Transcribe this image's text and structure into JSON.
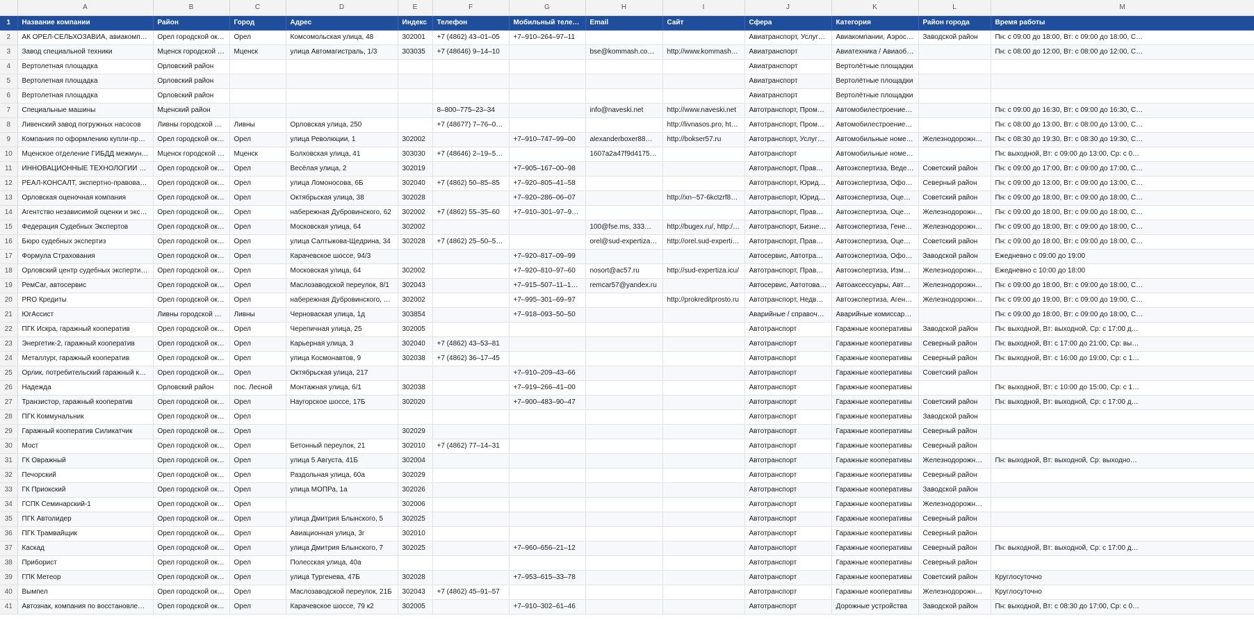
{
  "column_letters": [
    "A",
    "B",
    "C",
    "D",
    "E",
    "F",
    "G",
    "H",
    "I",
    "J",
    "K",
    "L",
    "M"
  ],
  "header_row_number": "1",
  "headers": [
    "Название компании",
    "Район",
    "Город",
    "Адрес",
    "Индекс",
    "Телефон",
    "Мобильный телефон",
    "Email",
    "Сайт",
    "Сфера",
    "Категория",
    "Район города",
    "Время работы"
  ],
  "rows": [
    {
      "n": "2",
      "c": [
        "АК ОРЕЛ-СЕЛЬХОЗАВИА, авиакомпан…",
        "Орел городской округ",
        "Орел",
        "Комсомольская улица, 48",
        "302001",
        "+7 (4862) 43–01–05",
        "+7–910–264–97–11",
        "",
        "",
        "Авиатранспорт, Услуги по…",
        "Авиакомпании, Аэросъёмка",
        "Заводской район",
        "Пн: с 09:00 до 18:00, Вт: с 09:00 до 18:00, С…"
      ]
    },
    {
      "n": "3",
      "c": [
        "Завод специальной техники",
        "Мценск городской окр…",
        "Мценск",
        "улица Автомагистраль, 1/3",
        "303035",
        "+7 (48646) 9–14–10",
        "",
        "bse@kommash.com, ex…",
        "http://www.kommash.com",
        "Авиатранспорт",
        "Авиатехника / Авиаобору…",
        "",
        "Пн: с 08:00 до 12:00, Вт: с 08:00 до 12:00, С…"
      ]
    },
    {
      "n": "4",
      "c": [
        "Вертолетная площадка",
        "Орловский район",
        "",
        "",
        "",
        "",
        "",
        "",
        "",
        "Авиатранспорт",
        "Вертолётные площадки",
        "",
        ""
      ]
    },
    {
      "n": "5",
      "c": [
        "Вертолетная площадка",
        "Орловский район",
        "",
        "",
        "",
        "",
        "",
        "",
        "",
        "Авиатранспорт",
        "Вертолётные площадки",
        "",
        ""
      ]
    },
    {
      "n": "6",
      "c": [
        "Вертолетная площадка",
        "Орловский район",
        "",
        "",
        "",
        "",
        "",
        "",
        "",
        "Авиатранспорт",
        "Вертолётные площадки",
        "",
        ""
      ]
    },
    {
      "n": "7",
      "c": [
        "Специальные машины",
        "Мценский район",
        "",
        "",
        "",
        "8–800–775–23–34",
        "",
        "info@naveski.net",
        "http://www.naveski.net",
        "Автотранспорт, Промышл…",
        "Автомобилестроение, Спе…",
        "",
        "Пн: с 09:00 до 16:30, Вт: с 09:00 до 16:30, С…"
      ]
    },
    {
      "n": "8",
      "c": [
        "Ливенский завод погружных насосов",
        "Ливны городской округ",
        "Ливны",
        "Орловская улица, 250",
        "",
        "+7 (48677) 7–76–01, +7…",
        "",
        "",
        "http://livnasos.pro, http://…",
        "Автотранспорт, Промышл…",
        "Автомобилестроение, Нас…",
        "",
        "Пн: с 08:00 до 13:00, Вт: с 08:00 до 13:00, С…"
      ]
    },
    {
      "n": "9",
      "c": [
        "Компания по оформлению купли-пр…",
        "Орел городской округ",
        "Орел",
        "улица Революции, 1",
        "302002",
        "",
        "+7–910–747–99–00",
        "alexanderboxer88@mail…",
        "http://bokser57.ru",
        "Автотранспорт, Услуги стр…",
        "Автомобильные номера, …",
        "Железнодорожный р…",
        "Пн: с 08:30 до 19:30, Вт: с 08:30 до 19:30, С…"
      ]
    },
    {
      "n": "10",
      "c": [
        "Мценское отделение ГИБДД межмун…",
        "Мценск городской окр…",
        "Мценск",
        "Болховская улица, 41",
        "303030",
        "+7 (48646) 2–19–51, +7…",
        "",
        "1607a2a47f9d41759563…",
        "",
        "Автотранспорт",
        "Автомобильные номера",
        "",
        "Пн: выходной, Вт: с 09:00 до 13:00, Ср: с 0…"
      ]
    },
    {
      "n": "11",
      "c": [
        "ИННОВАЦИОННЫЕ ТЕХНОЛОГИИ П…",
        "Орел городской округ",
        "Орел",
        "Весёлая улица, 2",
        "302019",
        "",
        "+7–905–167–00–98",
        "",
        "",
        "Автотранспорт, Правоохр…",
        "Автоэкспертиза, Ведение …",
        "Советский район",
        "Пн: с 09:00 до 17:00, Вт: с 09:00 до 17:00, С…"
      ]
    },
    {
      "n": "12",
      "c": [
        "РЕАЛ-КОНСАЛТ, экспертно-правовая …",
        "Орел городской округ",
        "Орел",
        "улица Ломоносова, 6Б",
        "302040",
        "+7 (4862) 50–85–85",
        "+7–920–805–41–58",
        "",
        "",
        "Автотранспорт, Юридичес…",
        "Автоэкспертиза, Оформле…",
        "Северный район",
        "Пн: с 09:00 до 13:00, Вт: с 09:00 до 13:00, С…"
      ]
    },
    {
      "n": "13",
      "c": [
        "Орловская оценочная компания",
        "Орел городской округ",
        "Орел",
        "Октябрьская улица, 38",
        "302028",
        "",
        "+7–920–286–06–07",
        "",
        "http://xn--57-6kctzrf8d.xn…",
        "Автотранспорт, Юридичес…",
        "Автоэкспертиза, Оценка с…",
        "Советский район",
        "Пн: с 09:00 до 18:00, Вт: с 09:00 до 18:00, С…"
      ]
    },
    {
      "n": "14",
      "c": [
        "Агентство независимой оценки и экс…",
        "Орел городской округ",
        "Орел",
        "набережная Дубровинского, 62",
        "302002",
        "+7 (4862) 55–35–60",
        "+7–910–301–97–90, +7…",
        "",
        "",
        "Автотранспорт, Правоохр…",
        "Автоэкспертиза, Оценка с…",
        "Железнодорожный р…",
        "Пн: с 09:00 до 18:00, Вт: с 09:00 до 18:00, С…"
      ]
    },
    {
      "n": "15",
      "c": [
        "Федерация Судебных Экспертов",
        "Орел городской округ",
        "Орел",
        "Московская улица, 64",
        "302002",
        "",
        "",
        "100@fse.ms, 333@fse.…",
        "http://bugex.ru/, http://kri…",
        "Автотранспорт, Бизнес-ус…",
        "Автоэкспертиза, Генетик, …",
        "Железнодорожный р…",
        "Пн: с 09:00 до 18:00, Вт: с 09:00 до 18:00, С…"
      ]
    },
    {
      "n": "16",
      "c": [
        "Бюро судебных экспертиз",
        "Орел городской округ",
        "Орел",
        "улица Салтыкова-Щедрина, 34",
        "302028",
        "+7 (4862) 25–50–52, 8–…",
        "",
        "orel@sud-expertiza.org",
        "http://orel.sud-expertiza.o…",
        "Автотранспорт, Правоохр…",
        "Автоэкспертиза, Оценка с…",
        "Советский район",
        "Пн: с 09:00 до 18:00, Вт: с 09:00 до 18:00, С…"
      ]
    },
    {
      "n": "17",
      "c": [
        "Формула Страхования",
        "Орел городской округ",
        "Орел",
        "Карачевское шоссе, 94/3",
        "",
        "",
        "+7–920–817–09–99",
        "",
        "",
        "Автосервис, Автотранспор…",
        "Автоэкспертиза, Оформле…",
        "Заводской район",
        "Ежедневно с 09:00 до 19:00"
      ]
    },
    {
      "n": "18",
      "c": [
        "Орловский центр судебных эксперти…",
        "Орел городской округ",
        "Орел",
        "Московская улица, 64",
        "302002",
        "",
        "+7–920–810–97–60",
        "nosort@ac57.ru",
        "http://sud-expertiza.icu/",
        "Автотранспорт, Правоохр…",
        "Автоэкспертиза, Измерен…",
        "Железнодорожный р…",
        "Ежедневно с 10:00 до 18:00"
      ]
    },
    {
      "n": "19",
      "c": [
        "РемCar, автосервис",
        "Орел городской округ",
        "Орел",
        "Маслозаводской переулок, 8/1",
        "302043",
        "",
        "+7–915–507–11–13, +7…",
        "remcar57@yandex.ru",
        "",
        "Автосервис, Автотовары, …",
        "Автоаксессуары, Автоэкс…",
        "Железнодорожный р…",
        "Пн: с 09:00 до 18:00, Вт: с 09:00 до 18:00, С…"
      ]
    },
    {
      "n": "20",
      "c": [
        "PRO Кредиты",
        "Орел городской округ",
        "Орел",
        "набережная Дубровинского, 6…",
        "302002",
        "",
        "+7–995–301–69–97",
        "",
        "http://prokreditprosto.ru",
        "Автотранспорт, Недвижим…",
        "Автоэкспертиза, Агентства…",
        "Железнодорожный р…",
        "Пн: с 09:00 до 19:00, Вт: с 09:00 до 19:00, С…"
      ]
    },
    {
      "n": "21",
      "c": [
        "ЮгАссист",
        "Ливны городской округ",
        "Ливны",
        "Черноваская улица, 1д",
        "303854",
        "",
        "+7–918–093–50–50",
        "",
        "",
        "Аварийные / справочные …",
        "Аварийные комиссары, Ав…",
        "",
        "Пн: с 09:00 до 18:00, Вт: с 09:00 до 18:00, С…"
      ]
    },
    {
      "n": "22",
      "c": [
        "ПГК Искра, гаражный кооператив",
        "Орел городской округ",
        "Орел",
        "Черепичная улица, 25",
        "302005",
        "",
        "",
        "",
        "",
        "Автотранспорт",
        "Гаражные кооперативы",
        "Заводской район",
        "Пн: выходной, Вт: выходной, Ср: с 17:00 д…"
      ]
    },
    {
      "n": "23",
      "c": [
        "Энергетик-2, гаражный кооператив",
        "Орел городской округ",
        "Орел",
        "Карьерная улица, 3",
        "302040",
        "+7 (4862) 43–53–81",
        "",
        "",
        "",
        "Автотранспорт",
        "Гаражные кооперативы",
        "Северный район",
        "Пн: выходной, Вт: с 17:00 до 21:00, Ср: вы…"
      ]
    },
    {
      "n": "24",
      "c": [
        "Металлург, гаражный кооператив",
        "Орел городской округ",
        "Орел",
        "улица Космонавтов, 9",
        "302038",
        "+7 (4862) 36–17–45",
        "",
        "",
        "",
        "Автотранспорт",
        "Гаражные кооперативы",
        "Северный район",
        "Пн: выходной, Вт: с 16:00 до 19:00, Ср: с 1…"
      ]
    },
    {
      "n": "25",
      "c": [
        "Орлик, потребительский гаражный к…",
        "Орел городской округ",
        "Орел",
        "Октябрьская улица, 217",
        "",
        "",
        "+7–910–209–43–66",
        "",
        "",
        "Автотранспорт",
        "Гаражные кооперативы",
        "Советский район",
        ""
      ]
    },
    {
      "n": "26",
      "c": [
        "Надежда",
        "Орловский район",
        "пос. Лесной",
        "Монтажная улица, 6/1",
        "302038",
        "",
        "+7–919–266–41–00",
        "",
        "",
        "Автотранспорт",
        "Гаражные кооперативы",
        "",
        "Пн: выходной, Вт: с 10:00 до 15:00, Ср: с 1…"
      ]
    },
    {
      "n": "27",
      "c": [
        "Транзистор, гаражный кооператив",
        "Орел городской округ",
        "Орел",
        "Наугорское шоссе, 17Б",
        "302020",
        "",
        "+7–900–483–90–47",
        "",
        "",
        "Автотранспорт",
        "Гаражные кооперативы",
        "Советский район",
        "Пн: выходной, Вт: выходной, Ср: с 17:00 д…"
      ]
    },
    {
      "n": "28",
      "c": [
        "ПГК Коммунальник",
        "Орел городской округ",
        "Орел",
        "",
        "",
        "",
        "",
        "",
        "",
        "Автотранспорт",
        "Гаражные кооперативы",
        "Заводской район",
        ""
      ]
    },
    {
      "n": "29",
      "c": [
        "Гаражный кооператив Силикатчик",
        "Орел городской округ",
        "Орел",
        "",
        "302029",
        "",
        "",
        "",
        "",
        "Автотранспорт",
        "Гаражные кооперативы",
        "Северный район",
        ""
      ]
    },
    {
      "n": "30",
      "c": [
        "Мост",
        "Орел городской округ",
        "Орел",
        "Бетонный переулок, 21",
        "302010",
        "+7 (4862) 77–14–31",
        "",
        "",
        "",
        "Автотранспорт",
        "Гаражные кооперативы",
        "Северный район",
        ""
      ]
    },
    {
      "n": "31",
      "c": [
        "ГК Овражный",
        "Орел городской округ",
        "Орел",
        "улица 5 Августа, 41Б",
        "302004",
        "",
        "",
        "",
        "",
        "Автотранспорт",
        "Гаражные кооперативы",
        "Железнодорожный р…",
        "Пн: выходной, Вт: выходной, Ср: выходно…"
      ]
    },
    {
      "n": "32",
      "c": [
        "Печорский",
        "Орел городской округ",
        "Орел",
        "Раздольная улица, 60а",
        "302029",
        "",
        "",
        "",
        "",
        "Автотранспорт",
        "Гаражные кооперативы",
        "Северный район",
        ""
      ]
    },
    {
      "n": "33",
      "c": [
        "ГК Приокский",
        "Орел городской округ",
        "Орел",
        "улица МОПРа, 1а",
        "302026",
        "",
        "",
        "",
        "",
        "Автотранспорт",
        "Гаражные кооперативы",
        "Заводской район",
        ""
      ]
    },
    {
      "n": "34",
      "c": [
        "ГСПК Семинарский-1",
        "Орел городской округ",
        "Орел",
        "",
        "302006",
        "",
        "",
        "",
        "",
        "Автотранспорт",
        "Гаражные кооперативы",
        "Железнодорожный р…",
        ""
      ]
    },
    {
      "n": "35",
      "c": [
        "ПГК Автолидер",
        "Орел городской округ",
        "Орел",
        "улица Дмитрия Блынского, 5",
        "302025",
        "",
        "",
        "",
        "",
        "Автотранспорт",
        "Гаражные кооперативы",
        "Северный район",
        ""
      ]
    },
    {
      "n": "36",
      "c": [
        "ПГК Трамвайщик",
        "Орел городской округ",
        "Орел",
        "Авиационная улица, 3г",
        "302010",
        "",
        "",
        "",
        "",
        "Автотранспорт",
        "Гаражные кооперативы",
        "Северный район",
        ""
      ]
    },
    {
      "n": "37",
      "c": [
        "Каскад",
        "Орел городской округ",
        "Орел",
        "улица Дмитрия Блынского, 7",
        "302025",
        "",
        "+7–960–656–21–12",
        "",
        "",
        "Автотранспорт",
        "Гаражные кооперативы",
        "Северный район",
        "Пн: выходной, Вт: выходной, Ср: с 17:00 д…"
      ]
    },
    {
      "n": "38",
      "c": [
        "Приборист",
        "Орел городской округ",
        "Орел",
        "Полесская улица, 40а",
        "",
        "",
        "",
        "",
        "",
        "Автотранспорт",
        "Гаражные кооперативы",
        "Северный район",
        ""
      ]
    },
    {
      "n": "39",
      "c": [
        "ГПК Метеор",
        "Орел городской округ",
        "Орел",
        "улица Тургенева, 47Б",
        "302028",
        "",
        "+7–953–615–33–78",
        "",
        "",
        "Автотранспорт",
        "Гаражные кооперативы",
        "Советский район",
        "Круглосуточно"
      ]
    },
    {
      "n": "40",
      "c": [
        "Вымпел",
        "Орел городской округ",
        "Орел",
        "Маслозаводской переулок, 21Б",
        "302043",
        "+7 (4862) 45–91–57",
        "",
        "",
        "",
        "Автотранспорт",
        "Гаражные кооперативы",
        "Железнодорожный р…",
        "Круглосуточно"
      ]
    },
    {
      "n": "41",
      "c": [
        "Автознак, компания по восстановлен…",
        "Орел городской округ",
        "Орел",
        "Карачевское шоссе, 79 к2",
        "302005",
        "",
        "+7–910–302–61–46",
        "",
        "",
        "Автотранспорт",
        "Дорожные устройства",
        "Заводской район",
        "Пн: выходной, Вт: с 08:30 до 17:00, Ср: с 0…"
      ]
    }
  ]
}
